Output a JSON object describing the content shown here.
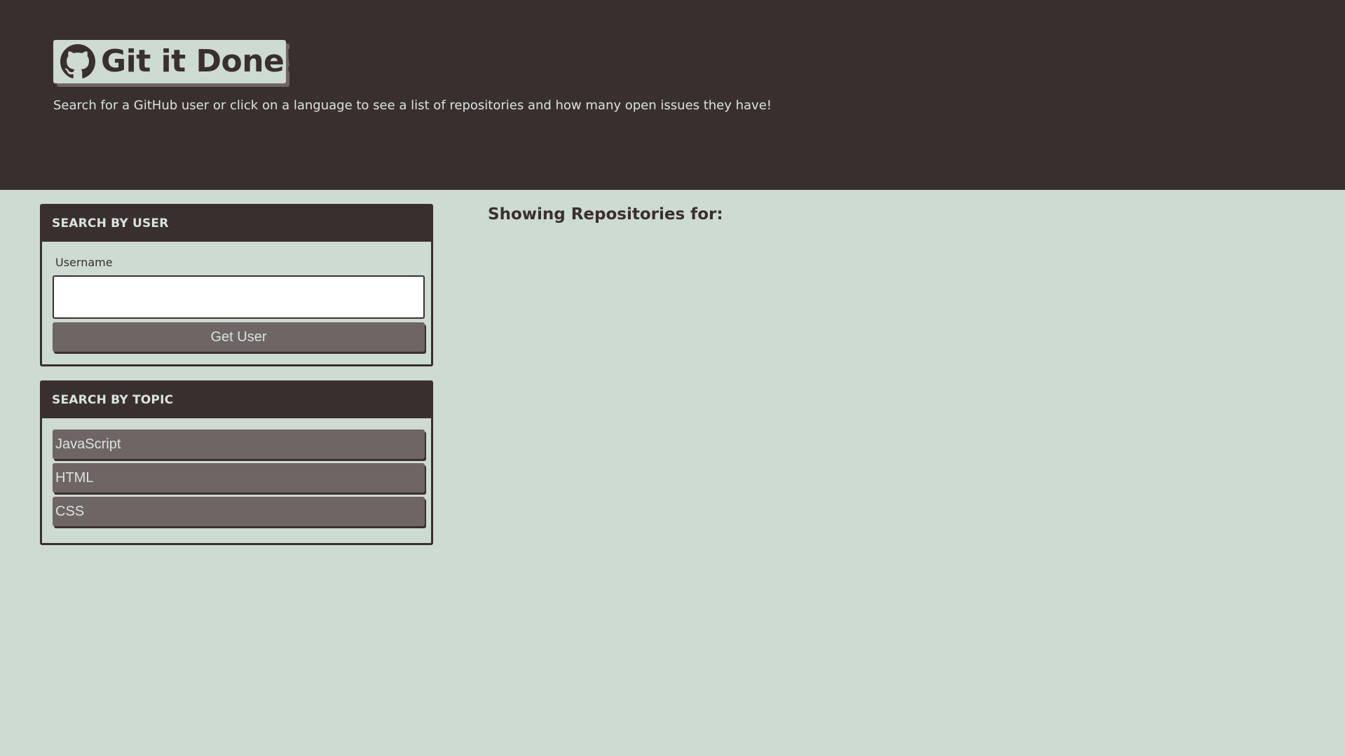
{
  "header": {
    "title": "Git it Done!",
    "subtitle": "Search for a GitHub user or click on a language to see a list of repositories and how many open issues they have!",
    "logo_icon": "github-icon"
  },
  "user_search": {
    "heading": "SEARCH BY USER",
    "username_label": "Username",
    "username_value": "",
    "button_label": "Get User"
  },
  "topic_search": {
    "heading": "SEARCH BY TOPIC",
    "topics": [
      {
        "label": "JavaScript"
      },
      {
        "label": "HTML"
      },
      {
        "label": "CSS"
      }
    ]
  },
  "results": {
    "heading": "Showing Repositories for:"
  },
  "colors": {
    "dark": "#3a2f2f",
    "background": "#cddbd2",
    "button": "#6f6565",
    "light_text": "#d9e4dd"
  }
}
